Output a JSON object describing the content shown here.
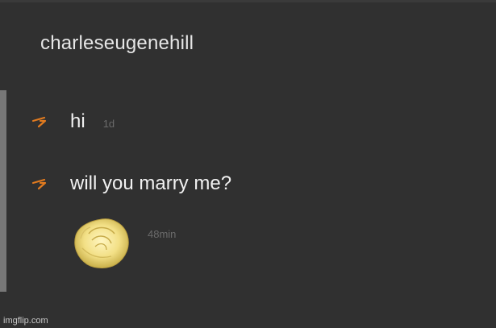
{
  "conversation": {
    "username": "charleseugenehill"
  },
  "messages": [
    {
      "text": "hi",
      "time": "1d",
      "icon": "reply-arrow-icon"
    },
    {
      "text": "will you marry me?",
      "time": "",
      "icon": "reply-arrow-icon"
    }
  ],
  "attachment": {
    "icon": "yellow-rose-image",
    "time": "48min"
  },
  "watermark": "imgflip.com",
  "colors": {
    "background": "#303030",
    "accent": "#e07a1f",
    "rose": "#f0e08a"
  }
}
